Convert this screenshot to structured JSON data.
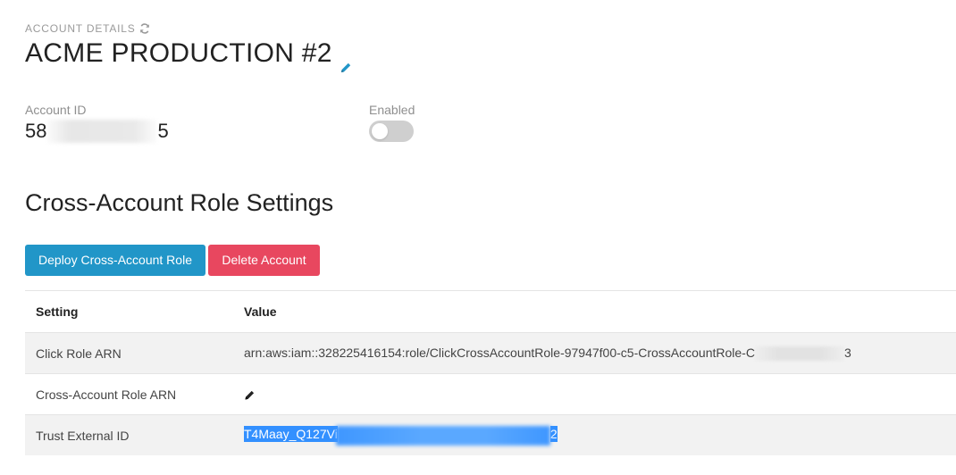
{
  "header": {
    "eyebrow": "ACCOUNT DETAILS",
    "title": "ACME PRODUCTION #2"
  },
  "account": {
    "id_label": "Account ID",
    "id_prefix": "58",
    "id_suffix": "5",
    "enabled_label": "Enabled",
    "enabled": false
  },
  "section": {
    "title": "Cross-Account Role Settings"
  },
  "buttons": {
    "deploy": "Deploy Cross-Account Role",
    "delete": "Delete Account"
  },
  "table": {
    "headers": [
      "Setting",
      "Value"
    ],
    "rows": [
      {
        "setting": "Click Role ARN",
        "value_prefix": "arn:aws:iam::328225416154:role/ClickCrossAccountRole-97947f00-c5-CrossAccountRole-C",
        "value_suffix": "3"
      },
      {
        "setting": "Cross-Account Role ARN",
        "value_icon": "pencil-icon"
      },
      {
        "setting": "Trust External ID",
        "value_prefix": "T4Maay_Q127Vi",
        "value_suffix": "2"
      }
    ]
  },
  "colors": {
    "primary": "#2196c8",
    "danger": "#e8475f",
    "selection": "#3390ff",
    "edit_icon": "#2196c8"
  }
}
